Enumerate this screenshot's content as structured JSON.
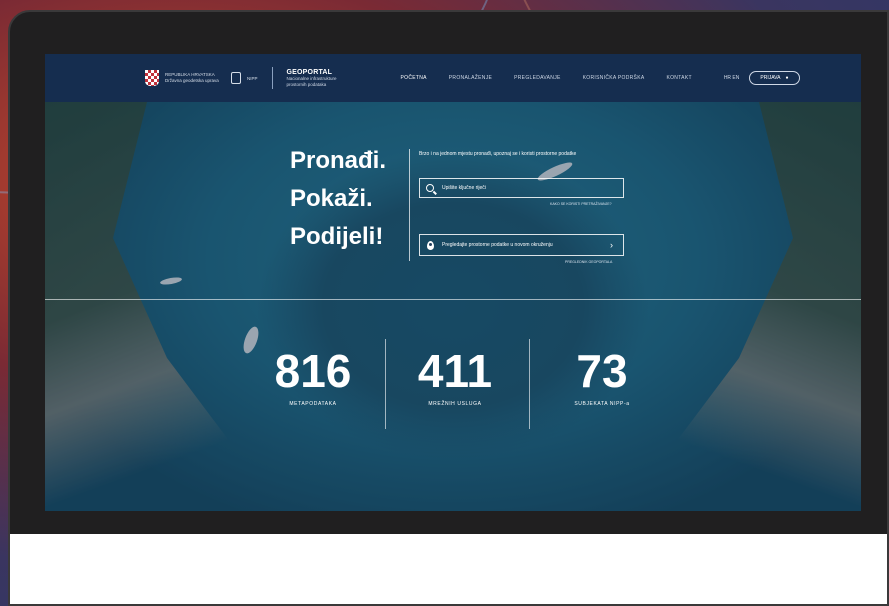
{
  "header": {
    "logo_text": "REPUBLIKA HRVATSKA Državna geodetska uprava",
    "partner_text": "NIPP",
    "brand_title": "GEOPORTAL",
    "brand_subtitle": "Nacionalne infrastrukture prostornih podataka",
    "nav": [
      "POČETNA",
      "PRONALAŽENJE",
      "PREGLEDAVANJE",
      "KORISNIČKA PODRŠKA",
      "KONTAKT"
    ],
    "lang": "HR  EN",
    "login_label": "PRIJAVA"
  },
  "hero": {
    "words": [
      "Pronađi.",
      "Pokaži.",
      "Podijeli!"
    ],
    "intro": "Brzo i na jednom mjestu pronađi, upoznaj se i koristi prostorne podatke",
    "search_placeholder": "Upišite ključne riječi",
    "search_help": "KAKO SE KORISTI PRETRAŽIVANJE?",
    "map_button": "Pregledajte prostorne podatke u novom okruženju",
    "map_help": "PREGLEDNIK GEOPORTALA"
  },
  "stats": [
    {
      "value": "816",
      "label": "METAPODATAKA"
    },
    {
      "value": "411",
      "label": "MREŽNIH USLUGA"
    },
    {
      "value": "73",
      "label": "SUBJEKATA NIPP-a"
    }
  ]
}
